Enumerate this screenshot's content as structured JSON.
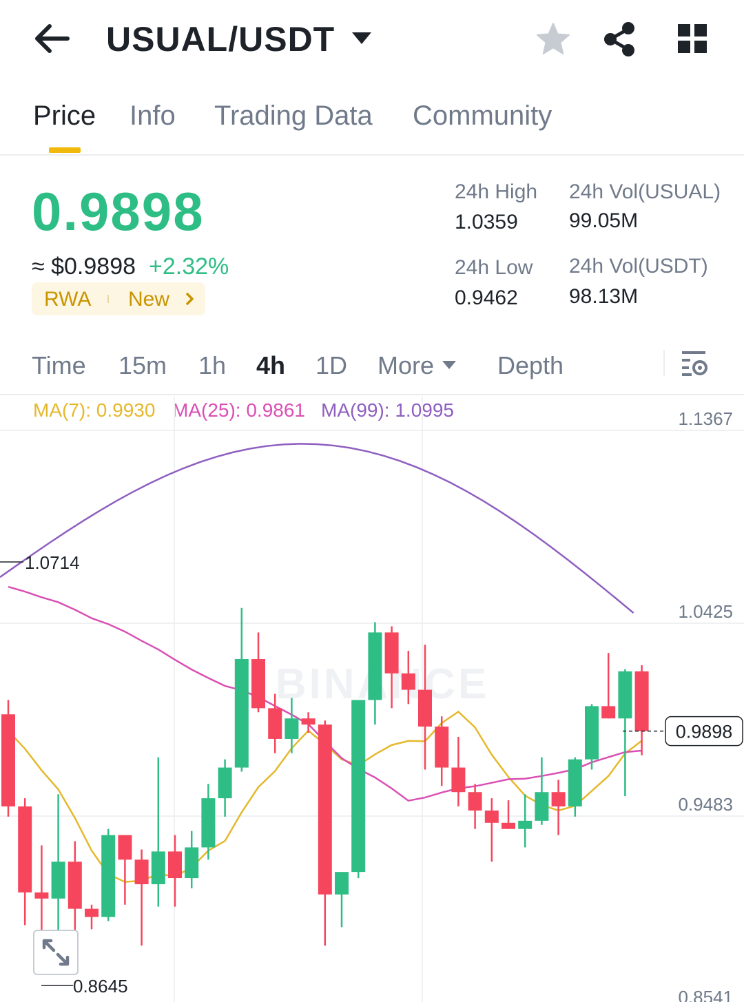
{
  "header": {
    "pair": "USUAL/USDT",
    "icons": [
      "back-arrow-icon",
      "dropdown-caret-icon",
      "star-icon",
      "share-icon",
      "grid-icon"
    ]
  },
  "tabs": [
    {
      "label": "Price",
      "active": true
    },
    {
      "label": "Info",
      "active": false
    },
    {
      "label": "Trading Data",
      "active": false
    },
    {
      "label": "Community",
      "active": false
    }
  ],
  "ticker": {
    "last_price": "0.9898",
    "usd_price": "≈ $0.9898",
    "change": "+2.32%",
    "tags": [
      "RWA",
      "New"
    ],
    "high_label": "24h High",
    "high_value": "1.0359",
    "low_label": "24h Low",
    "low_value": "0.9462",
    "vol_base_label": "24h Vol(USUAL)",
    "vol_base_value": "99.05M",
    "vol_quote_label": "24h Vol(USDT)",
    "vol_quote_value": "98.13M"
  },
  "intervals": {
    "items": [
      "Time",
      "15m",
      "1h",
      "4h",
      "1D",
      "More",
      "Depth"
    ],
    "active": "4h"
  },
  "indicators": {
    "ma7": "MA(7): 0.9930",
    "ma25": "MA(25): 0.9861",
    "ma99": "MA(99): 1.0995"
  },
  "colors": {
    "up": "#2ebd85",
    "down": "#f6465d",
    "ma7": "#e5b82c",
    "ma25": "#da4fb4",
    "ma99": "#8e5fc0",
    "accent": "#f0b90b"
  },
  "chart_data": {
    "type": "candlestick",
    "interval": "4h",
    "y_ticks": [
      "1.1367",
      "1.0425",
      "0.9483",
      "0.8541"
    ],
    "ylim": [
      0.8541,
      1.1367
    ],
    "current_price_label": "0.9898",
    "high_marker": "1.0714",
    "low_marker": "0.8645",
    "watermark": "BINANCE",
    "candles": [
      {
        "o": 0.998,
        "h": 1.005,
        "l": 0.948,
        "c": 0.953
      },
      {
        "o": 0.953,
        "h": 0.957,
        "l": 0.895,
        "c": 0.911
      },
      {
        "o": 0.911,
        "h": 0.934,
        "l": 0.889,
        "c": 0.908
      },
      {
        "o": 0.908,
        "h": 0.959,
        "l": 0.89,
        "c": 0.926
      },
      {
        "o": 0.926,
        "h": 0.936,
        "l": 0.887,
        "c": 0.903
      },
      {
        "o": 0.903,
        "h": 0.905,
        "l": 0.893,
        "c": 0.899
      },
      {
        "o": 0.899,
        "h": 0.942,
        "l": 0.897,
        "c": 0.939
      },
      {
        "o": 0.939,
        "h": 0.939,
        "l": 0.905,
        "c": 0.927
      },
      {
        "o": 0.927,
        "h": 0.932,
        "l": 0.885,
        "c": 0.915
      },
      {
        "o": 0.915,
        "h": 0.977,
        "l": 0.904,
        "c": 0.931
      },
      {
        "o": 0.931,
        "h": 0.939,
        "l": 0.904,
        "c": 0.918
      },
      {
        "o": 0.918,
        "h": 0.941,
        "l": 0.913,
        "c": 0.933
      },
      {
        "o": 0.933,
        "h": 0.964,
        "l": 0.927,
        "c": 0.957
      },
      {
        "o": 0.957,
        "h": 0.976,
        "l": 0.948,
        "c": 0.972
      },
      {
        "o": 0.972,
        "h": 1.05,
        "l": 0.97,
        "c": 1.025
      },
      {
        "o": 1.025,
        "h": 1.038,
        "l": 0.999,
        "c": 1.001
      },
      {
        "o": 1.001,
        "h": 1.008,
        "l": 0.979,
        "c": 0.986
      },
      {
        "o": 0.986,
        "h": 1.006,
        "l": 0.979,
        "c": 0.996
      },
      {
        "o": 0.996,
        "h": 0.999,
        "l": 0.989,
        "c": 0.993
      },
      {
        "o": 0.993,
        "h": 0.995,
        "l": 0.885,
        "c": 0.91
      },
      {
        "o": 0.91,
        "h": 0.92,
        "l": 0.894,
        "c": 0.921
      },
      {
        "o": 0.921,
        "h": 1.005,
        "l": 0.918,
        "c": 1.005
      },
      {
        "o": 1.005,
        "h": 1.043,
        "l": 0.993,
        "c": 1.038
      },
      {
        "o": 1.038,
        "h": 1.041,
        "l": 1.001,
        "c": 1.018
      },
      {
        "o": 1.018,
        "h": 1.029,
        "l": 1.003,
        "c": 1.01
      },
      {
        "o": 1.01,
        "h": 1.032,
        "l": 0.971,
        "c": 0.992
      },
      {
        "o": 0.992,
        "h": 0.997,
        "l": 0.963,
        "c": 0.972
      },
      {
        "o": 0.972,
        "h": 0.987,
        "l": 0.953,
        "c": 0.96
      },
      {
        "o": 0.96,
        "h": 0.964,
        "l": 0.942,
        "c": 0.951
      },
      {
        "o": 0.951,
        "h": 0.957,
        "l": 0.926,
        "c": 0.945
      },
      {
        "o": 0.945,
        "h": 0.956,
        "l": 0.942,
        "c": 0.942
      },
      {
        "o": 0.942,
        "h": 0.959,
        "l": 0.933,
        "c": 0.946
      },
      {
        "o": 0.946,
        "h": 0.977,
        "l": 0.944,
        "c": 0.96
      },
      {
        "o": 0.96,
        "h": 0.966,
        "l": 0.939,
        "c": 0.953
      },
      {
        "o": 0.953,
        "h": 0.977,
        "l": 0.948,
        "c": 0.976
      },
      {
        "o": 0.976,
        "h": 1.003,
        "l": 0.971,
        "c": 1.002
      },
      {
        "o": 1.002,
        "h": 1.028,
        "l": 0.996,
        "c": 0.996
      },
      {
        "o": 0.996,
        "h": 1.02,
        "l": 0.958,
        "c": 1.019
      },
      {
        "o": 1.019,
        "h": 1.022,
        "l": 0.978,
        "c": 0.9898
      }
    ]
  }
}
